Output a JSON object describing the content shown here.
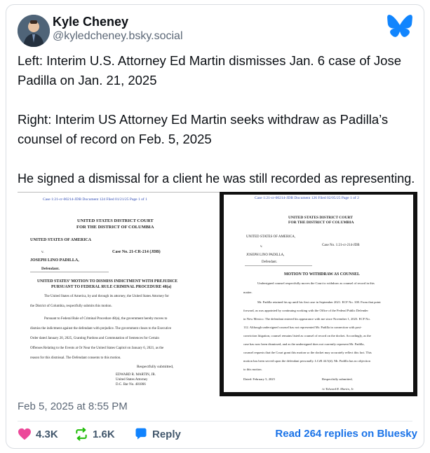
{
  "post": {
    "author_name": "Kyle Cheney",
    "handle": "@kyledcheney.bsky.social",
    "paragraphs": [
      "Left: Interim U.S. Attorney Ed Martin dismisses Jan. 6 case of Jose Padilla on Jan. 21, 2025",
      "Right: Interim US Attorney Ed Martin seeks withdraw as Padilla’s counsel of record on Feb. 5, 2025",
      "He signed a dismissal for a client he was still recorded as representing."
    ],
    "timestamp": "Feb 5, 2025 at 8:55 PM"
  },
  "doc_left": {
    "header": "Case 1:21-cr-00214-JDB     Document 124     Filed 01/21/25     Page 1 of 1",
    "court": [
      "UNITED STATES DISTRICT COURT",
      "FOR THE DISTRICT OF COLUMBIA"
    ],
    "party1": "UNITED STATES OF AMERICA",
    "v": "v.",
    "party2": "JOSEPH LINO PADILLA,",
    "defendant": "Defendant.",
    "case_no": "Case No. 21-CR-214 (JDB)",
    "motion_title": [
      "UNITED STATES’ MOTION TO DISMISS INDICTMENT WITH PREJUDICE",
      "PURSUANT TO FEDERAL RULE CRIMINAL PROCEDURE 48(a)"
    ],
    "body": [
      "The United States of America, by and through its attorney, the United States Attorney for",
      "the District of Columbia, respectfully submits this motion.",
      "Pursuant to Federal Rule of Criminal Procedure 48(a), the government hereby moves to",
      "dismiss the indictment against the defendant with prejudice. The government closes to the Executive",
      "Order dated January 20, 2025, Granting Pardons and Commutation of Sentences for Certain",
      "Offenses Relating to the Events at Or Near the United States Capitol on January 6, 2021, as the",
      "reason for this dismissal. The Defendant consents to this motion."
    ],
    "signoff": "Respectfully submitted,",
    "signature": [
      "EDWARD R. MARTIN, JR.",
      "United States Attorney",
      "D.C. Bar No. 481866"
    ]
  },
  "doc_right": {
    "header": "Case 1:21-cr-00214-JDB     Document 126     Filed 02/05/25     Page 1 of 2",
    "court": [
      "UNITED STATES DISTRICT COURT",
      "FOR THE DISTRICT OF COLUMBIA"
    ],
    "party1": "UNITED STATES OF AMERICA,",
    "v": "v.",
    "party2": "JOSEPH LINO PADILLA,",
    "defendant": "Defendant.",
    "case_no": "Case No. 1:21-cr-214-JDB",
    "motion_title": "MOTION TO WITHDRAW AS COUNSEL",
    "body": [
      "Undersigned counsel respectfully moves the Court to withdraw as counsel of record in this",
      "matter.",
      "Mr. Padilla retained his up until his first case in September 2021. ECF No. 108. From that point",
      "forward, as was appointed by continuing working with the Office of the Federal Public Defender",
      "in New Mexico. The defendant entered his appearance with me since November 1, 2023. ECF No.",
      "112. Although undersigned counsel has not represented Mr. Padilla in connection with post-",
      "conviction litigation, counsel remains listed as counsel of record on the docket. Accordingly, as the",
      "case has now been dismissed, and as the undersigned does not currently represent Mr. Padilla,",
      "counsel requests that the Court grant this motion so the docket may accurately reflect this fact. This",
      "motion has been served upon the defendant personally. LCrR 44.5(d). Mr. Padilla has no objection",
      "to this motion."
    ],
    "dated": "Dated: February 5, 2025",
    "signoff": "Respectfully submitted,",
    "signature": "/s/ Edward R. Martin, Jr."
  },
  "actions": {
    "likes": "4.3K",
    "reposts": "1.6K",
    "reply_label": "Reply",
    "read_replies": "Read 264 replies on Bluesky"
  },
  "colors": {
    "like": "#ec4899",
    "repost": "#20bc07",
    "reply": "#1083fe",
    "link": "#1a73e8",
    "brand": "#1185fe"
  }
}
